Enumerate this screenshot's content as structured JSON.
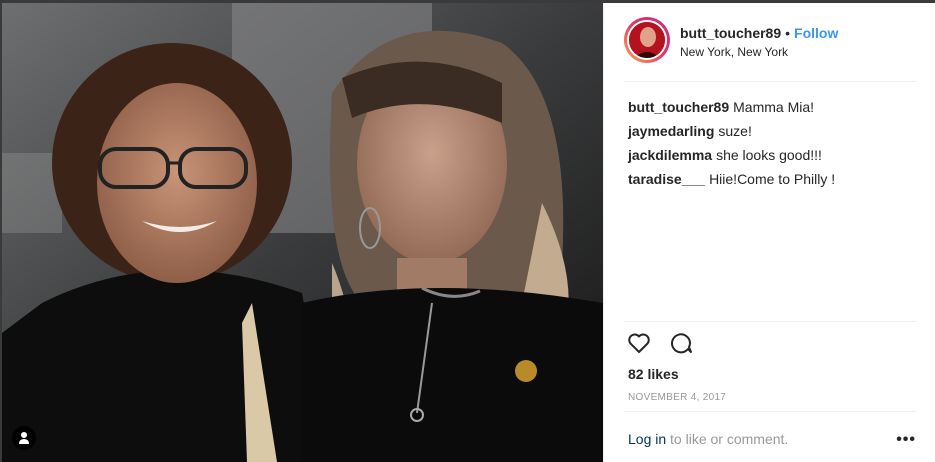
{
  "post": {
    "username": "butt_toucher89",
    "separator": "•",
    "follow_label": "Follow",
    "location": "New York, New York",
    "comments": [
      {
        "user": "butt_toucher89",
        "text": "Mamma Mia!"
      },
      {
        "user": "jaymedarling",
        "text": "suze!"
      },
      {
        "user": "jackdilemma",
        "text": "she looks good!!!"
      },
      {
        "user": "taradise___",
        "text": "Hiie!Come to Philly !"
      }
    ],
    "likes": "82 likes",
    "date": "NOVEMBER 4, 2017",
    "login_link": "Log in",
    "login_text": "to like or comment.",
    "more_label": "•••"
  },
  "icons": {
    "like": "heart-icon",
    "comment": "comment-bubble-icon",
    "tag": "person-tag-icon",
    "more": "more-options-icon"
  },
  "colors": {
    "accent": "#3897f0",
    "link": "#003569",
    "muted": "#999999",
    "border": "#efefef"
  }
}
